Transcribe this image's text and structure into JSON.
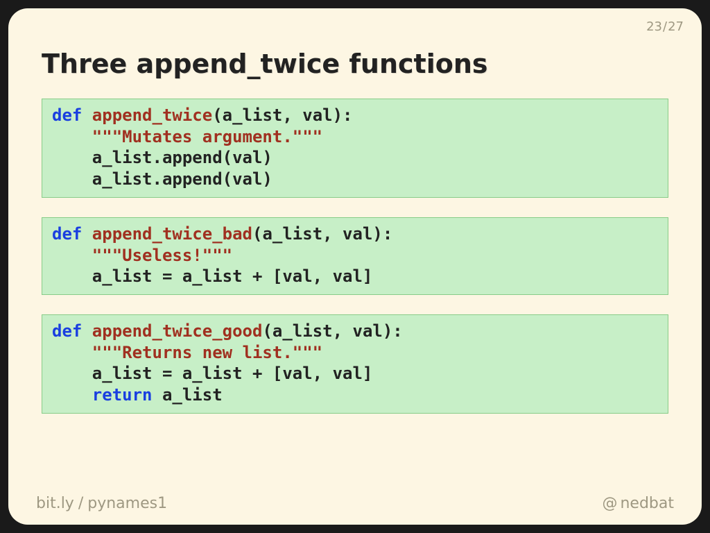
{
  "page": {
    "current": "23",
    "total": "27",
    "sep": "/"
  },
  "title": "Three append_twice functions",
  "code": {
    "block1": {
      "l1": {
        "kw": "def",
        "fn": " append_twice",
        "args": "(a_list, val):"
      },
      "l2": {
        "indent": "    ",
        "doc": "\"\"\"Mutates argument.\"\"\""
      },
      "l3": {
        "indent": "    ",
        "txt": "a_list.append(val)"
      },
      "l4": {
        "indent": "    ",
        "txt": "a_list.append(val)"
      }
    },
    "block2": {
      "l1": {
        "kw": "def",
        "fn": " append_twice_bad",
        "args": "(a_list, val):"
      },
      "l2": {
        "indent": "    ",
        "doc": "\"\"\"Useless!\"\"\""
      },
      "l3": {
        "indent": "    ",
        "txt": "a_list = a_list + [val, val]"
      }
    },
    "block3": {
      "l1": {
        "kw": "def",
        "fn": " append_twice_good",
        "args": "(a_list, val):"
      },
      "l2": {
        "indent": "    ",
        "doc": "\"\"\"Returns new list.\"\"\""
      },
      "l3": {
        "indent": "    ",
        "txt": "a_list = a_list + [val, val]"
      },
      "l4": {
        "indent": "    ",
        "kw": "return",
        "txt": " a_list"
      }
    }
  },
  "footer": {
    "short_domain": "bit.ly",
    "sep": "/",
    "slug": "pynames1",
    "at": "@",
    "handle": "nedbat"
  }
}
